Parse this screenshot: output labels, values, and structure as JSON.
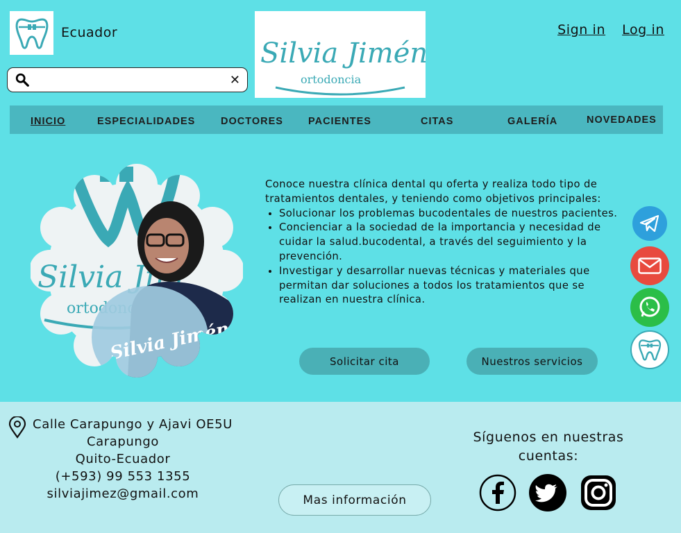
{
  "header": {
    "country": "Ecuador",
    "search": {
      "value": "",
      "placeholder": ""
    },
    "brand": {
      "name": "Silvia Jiménez",
      "tagline": "ortodoncia"
    },
    "auth": {
      "sign_in": "Sign in",
      "log_in": "Log in"
    }
  },
  "nav": {
    "items": [
      {
        "label": "INICIO",
        "active": true
      },
      {
        "label": "ESPECIALIDADES",
        "active": false
      },
      {
        "label": "DOCTORES",
        "active": false
      },
      {
        "label": "PACIENTES",
        "active": false
      },
      {
        "label": "CITAS",
        "active": false
      },
      {
        "label": "GALERÍA",
        "active": false
      },
      {
        "label": "NOVEDADES",
        "active": false
      }
    ]
  },
  "hero": {
    "photo_sign_top": "Silvia Jim",
    "photo_sign_sub": "ortodonc",
    "photo_balloon": "Silvia Jiméne",
    "intro": "Conoce nuestra clínica dental qu oferta y realiza todo tipo de tratamientos dentales, y teniendo como objetivos principales:",
    "objectives": [
      "Solucionar los problemas bucodentales de nuestros pacientes.",
      "Concienciar a la sociedad de la importancia y necesidad de cuidar la salud.bucodental, a través del seguimiento y la prevención.",
      "Investigar y desarrollar nuevas técnicas y materiales que permitan dar soluciones a todos los tratamientos que se realizan en nuestra clínica."
    ],
    "buttons": {
      "appointment": "Solicitar cita",
      "services": "Nuestros servicios"
    }
  },
  "contact_icons": [
    "telegram-icon",
    "email-icon",
    "whatsapp-icon",
    "tooth-logo-icon"
  ],
  "footer": {
    "address_lines": [
      "Calle Carapungo y Ajavi OE5U",
      "Carapungo",
      "Quito-Ecuador",
      "(+593) 99 553 1355",
      "silviajimez@gmail.com"
    ],
    "more_info": "Mas información",
    "follow_text": "Síguenos en nuestras cuentas:",
    "social": [
      "facebook-icon",
      "twitter-icon",
      "instagram-icon"
    ]
  },
  "colors": {
    "background": "#5ee0e6",
    "nav_bar": "#4ab7c0",
    "button": "#4ab0b6",
    "footer": "#b9ebef",
    "brand_teal": "#3aa9b5",
    "telegram": "#2ea0dc",
    "email": "#e84a3e",
    "whatsapp": "#2bbe48"
  }
}
